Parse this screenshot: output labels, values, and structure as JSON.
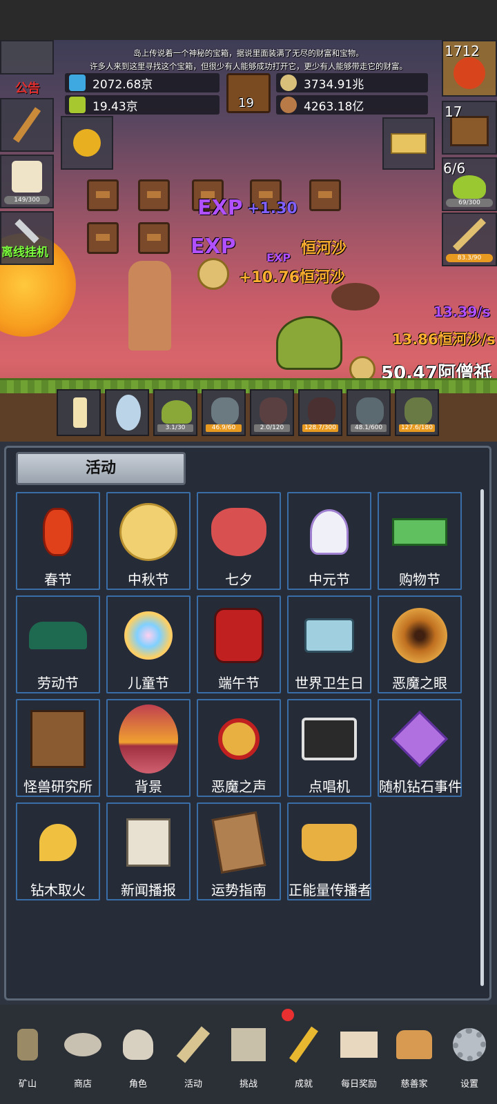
{
  "story": {
    "line1": "岛上传说着一个神秘的宝箱，据说里面装满了无尽的财富和宝物。",
    "line2": "许多人来到这里寻找这个宝箱，但很少有人能够成功打开它，更少有人能够带走它的财富。"
  },
  "resources": {
    "blue": "2072.68京",
    "green": "19.43京",
    "coin": "3734.91兆",
    "bag": "4263.18亿",
    "book_count": "19"
  },
  "left": {
    "notice": "公告",
    "milk_bar": "149/300",
    "offline": "离线挂机"
  },
  "right": {
    "potion_count": "1712",
    "chest_count": "17",
    "slime_count": "6/6",
    "slime_bar": "69/300",
    "sword_bar": "83.3/90"
  },
  "floats": {
    "exp1": "EXP",
    "exp1_val": "+1.30",
    "exp2": "EXP",
    "exp3": "EXP",
    "river1": "恒河沙",
    "river2": "+10.76恒河沙",
    "gain_rate": "13.39/s",
    "river_rate": "13.86恒河沙/s",
    "total": "50.47阿僧祇"
  },
  "slots": [
    {
      "bar": ""
    },
    {
      "bar": ""
    },
    {
      "bar": "3.1/30"
    },
    {
      "bar": "46.9/60"
    },
    {
      "bar": "2.0/120"
    },
    {
      "bar": "128.7/300"
    },
    {
      "bar": "48.1/600"
    },
    {
      "bar": "127.6/180"
    }
  ],
  "panel": {
    "title": "活动"
  },
  "tiles": [
    {
      "name": "春节",
      "icon": "lantern-icon"
    },
    {
      "name": "中秋节",
      "icon": "moon-icon"
    },
    {
      "name": "七夕",
      "icon": "heart-icon"
    },
    {
      "name": "中元节",
      "icon": "ghost-icon"
    },
    {
      "name": "购物节",
      "icon": "cash-icon"
    },
    {
      "name": "劳动节",
      "icon": "brush-icon"
    },
    {
      "name": "儿童节",
      "icon": "lollipop-icon"
    },
    {
      "name": "端午节",
      "icon": "dragon-mask-icon"
    },
    {
      "name": "世界卫生日",
      "icon": "ambulance-icon"
    },
    {
      "name": "恶魔之眼",
      "icon": "eye-icon"
    },
    {
      "name": "怪兽研究所",
      "icon": "lab-icon"
    },
    {
      "name": "背景",
      "icon": "sunset-icon"
    },
    {
      "name": "恶魔之声",
      "icon": "bell-icon"
    },
    {
      "name": "点唱机",
      "icon": "cassette-icon"
    },
    {
      "name": "随机钻石事件",
      "icon": "diamond-icon"
    },
    {
      "name": "钻木取火",
      "icon": "torch-icon"
    },
    {
      "name": "新闻播报",
      "icon": "newspaper-icon"
    },
    {
      "name": "运势指南",
      "icon": "fortune-icon"
    },
    {
      "name": "正能量传播者",
      "icon": "crown-icon"
    }
  ],
  "nav": [
    {
      "label": "矿山"
    },
    {
      "label": "商店"
    },
    {
      "label": "角色"
    },
    {
      "label": "活动"
    },
    {
      "label": "挑战"
    },
    {
      "label": "成就"
    },
    {
      "label": "每日奖励"
    },
    {
      "label": "慈善家"
    },
    {
      "label": "设置"
    }
  ]
}
